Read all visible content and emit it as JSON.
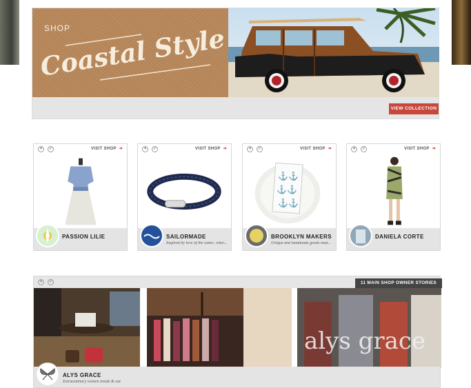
{
  "hero": {
    "shop_label": "SHOP",
    "script_title": "Coastal Styles",
    "view_button": "VIEW COLLECTION"
  },
  "cards": [
    {
      "visit": "VISIT SHOP",
      "name": "PASSION LILIE",
      "tagline": ""
    },
    {
      "visit": "VISIT SHOP",
      "name": "SAILORMADE",
      "tagline": "Inspired by love of the water...wher..."
    },
    {
      "visit": "VISIT SHOP",
      "name": "BROOKLYN MAKERS",
      "tagline": "Unique and handmade goods mad..."
    },
    {
      "visit": "VISIT SHOP",
      "name": "DANIELA CORTE",
      "tagline": ""
    }
  ],
  "story": {
    "badge": "11 MAIN SHOP OWNER STORIES",
    "name": "ALYS GRACE",
    "tagline": "Extraordinary women inside & out",
    "window_text": "alys grace"
  },
  "icons": {
    "heart": "heart-icon",
    "pin": "pinterest-icon",
    "arrow": "arrow-right-icon"
  },
  "colors": {
    "accent": "#c8463a",
    "badge": "#444444",
    "footer_gray": "#e4e4e4"
  }
}
